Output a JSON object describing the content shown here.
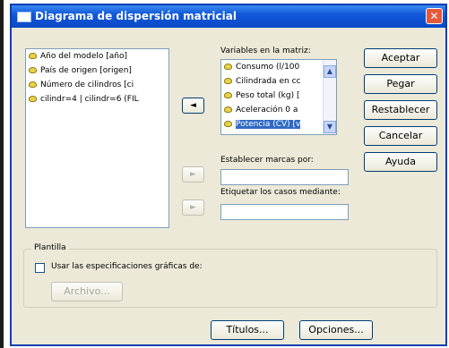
{
  "window": {
    "title": "Diagrama de dispersión matricial",
    "close_glyph": "✕"
  },
  "source_list": {
    "items": [
      {
        "label": "Año del modelo [año]",
        "icon": "ruler-variable-icon"
      },
      {
        "label": "País de origen [origen]",
        "icon": "ruler-variable-icon"
      },
      {
        "label": "Número de cilindros [ci",
        "icon": "ruler-variable-icon"
      },
      {
        "label": "cilindr=4 | cilindr=6 (FIL",
        "icon": "ruler-variable-icon"
      }
    ]
  },
  "matrix_variables": {
    "label": "Variables en la matriz:",
    "items": [
      {
        "label": "Consumo (l/100",
        "selected": false
      },
      {
        "label": "Cilindrada en cc",
        "selected": false
      },
      {
        "label": "Peso total (kg) [",
        "selected": false
      },
      {
        "label": "Aceleración 0 a",
        "selected": false
      },
      {
        "label": "Potencia (CV) [v",
        "selected": true
      }
    ]
  },
  "move_buttons": {
    "matrix": "◄",
    "markers": "►",
    "case_labels": "►"
  },
  "markers_field": {
    "label": "Establecer marcas por:",
    "value": ""
  },
  "case_labels_field": {
    "label": "Etiquetar los casos mediante:",
    "value": ""
  },
  "buttons": {
    "accept": "Aceptar",
    "paste": "Pegar",
    "reset": "Restablecer",
    "cancel": "Cancelar",
    "help": "Ayuda"
  },
  "template": {
    "group_label": "Plantilla",
    "checkbox_label": "Usar las especificaciones gráficas de:",
    "checked": false,
    "file_button": "Archivo..."
  },
  "bottom_buttons": {
    "titles": "Títulos...",
    "options": "Opciones..."
  }
}
